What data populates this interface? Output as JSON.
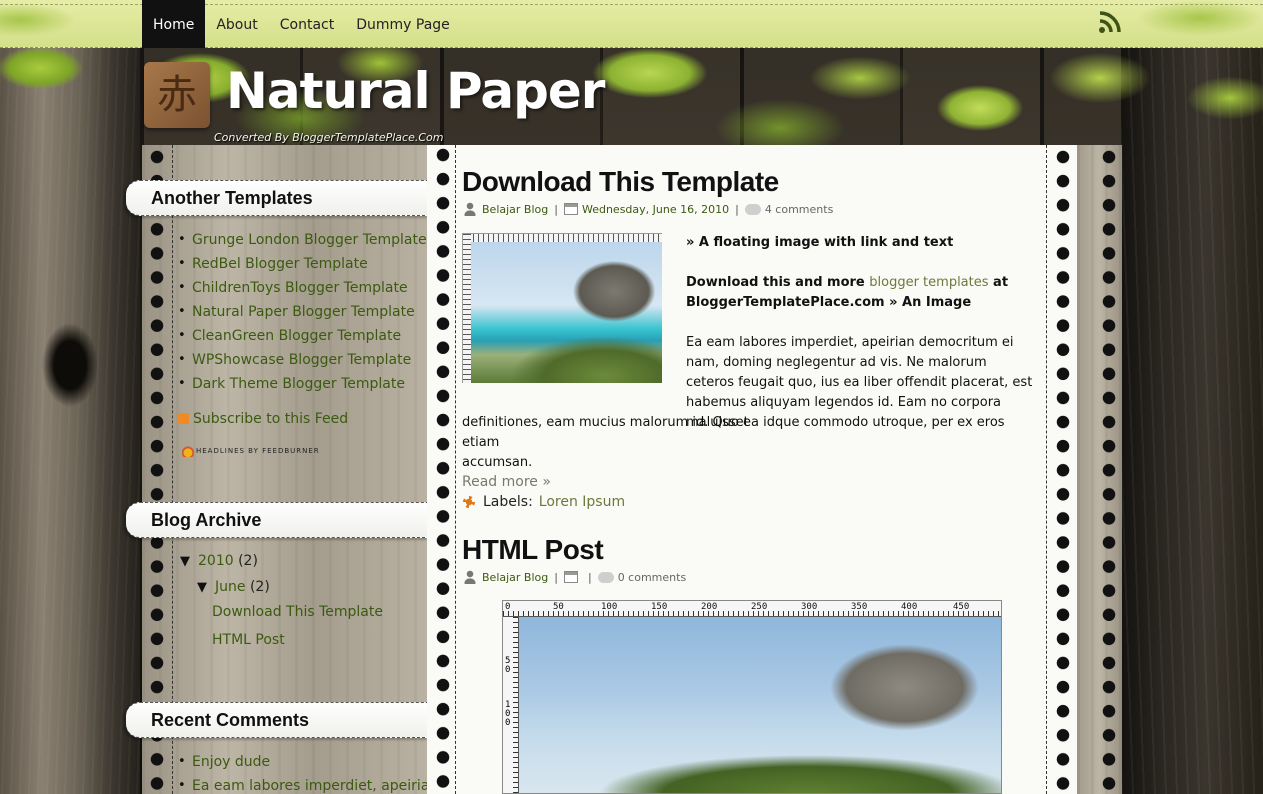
{
  "nav": {
    "items": [
      "Home",
      "About",
      "Contact",
      "Dummy Page"
    ],
    "active": "Home",
    "rss_icon": "rss-icon"
  },
  "header": {
    "logo_glyph": "赤",
    "title": "Natural Paper",
    "subtitle": "Converted By BloggerTemplatePlace.Com"
  },
  "sidebar": {
    "widgets": {
      "another_templates": {
        "title": "Another Templates",
        "items": [
          "Grunge London Blogger Template",
          "RedBel Blogger Template",
          "ChildrenToys Blogger Template",
          "Natural Paper Blogger Template",
          "CleanGreen Blogger Template",
          "WPShowcase Blogger Template",
          "Dark Theme Blogger Template"
        ],
        "subscribe": "Subscribe to this Feed",
        "feedburner": "HEADLINES BY FEEDBURNER"
      },
      "blog_archive": {
        "title": "Blog Archive",
        "year": "2010",
        "year_count": "(2)",
        "month": "June",
        "month_count": "(2)",
        "posts": [
          "Download This Template",
          "HTML Post"
        ],
        "expanded_glyph": "▼"
      },
      "recent_comments": {
        "title": "Recent Comments",
        "items": [
          "Enjoy dude",
          "Ea eam labores imperdiet, apeirian"
        ]
      }
    }
  },
  "posts": [
    {
      "title": "Download This Template",
      "author": "Belajar Blog",
      "date": "Wednesday, June 16, 2010",
      "comments": "4 comments",
      "line1": "» A floating image with link and text",
      "line2a": "Download this and more ",
      "line2link": "blogger templates",
      "line2b": " at",
      "line3": "BloggerTemplatePlace.com » An Image",
      "para_wrapped": "Ea eam labores imperdiet, apeirian democritum ei nam, doming neglegentur ad vis. Ne malorum ceteros feugait quo, ius ea liber offendit placerat, est habemus aliquyam legendos id. Eam no corpora maluisset",
      "para_full1": "definitiones, eam mucius malorum id. Quo ea idque commodo utroque, per ex eros etiam",
      "para_full2": "accumsan.",
      "read_more": "Read more »",
      "labels_label": "Labels:",
      "label": "Loren Ipsum"
    },
    {
      "title": "HTML Post",
      "author": "Belajar Blog",
      "comments": "0 comments",
      "ruler_top": [
        "0",
        "50",
        "100",
        "150",
        "200",
        "250",
        "300",
        "350",
        "400",
        "450"
      ],
      "ruler_left": [
        "5\n0",
        "1\n0\n0"
      ]
    }
  ]
}
